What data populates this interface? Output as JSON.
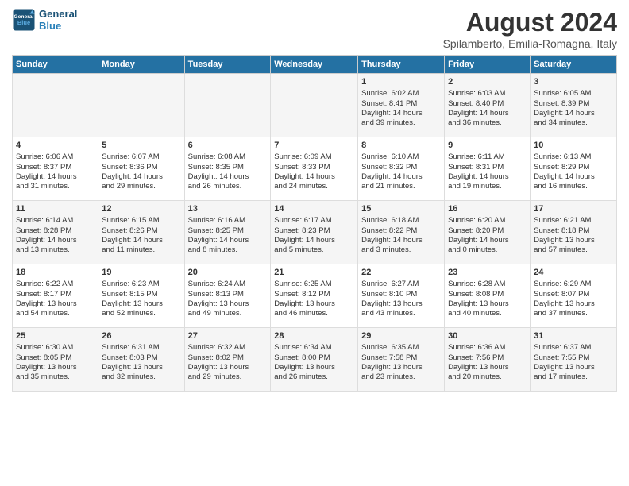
{
  "logo": {
    "line1": "General",
    "line2": "Blue"
  },
  "title": "August 2024",
  "subtitle": "Spilamberto, Emilia-Romagna, Italy",
  "days_of_week": [
    "Sunday",
    "Monday",
    "Tuesday",
    "Wednesday",
    "Thursday",
    "Friday",
    "Saturday"
  ],
  "weeks": [
    [
      {
        "day": "",
        "content": ""
      },
      {
        "day": "",
        "content": ""
      },
      {
        "day": "",
        "content": ""
      },
      {
        "day": "",
        "content": ""
      },
      {
        "day": "1",
        "content": "Sunrise: 6:02 AM\nSunset: 8:41 PM\nDaylight: 14 hours\nand 39 minutes."
      },
      {
        "day": "2",
        "content": "Sunrise: 6:03 AM\nSunset: 8:40 PM\nDaylight: 14 hours\nand 36 minutes."
      },
      {
        "day": "3",
        "content": "Sunrise: 6:05 AM\nSunset: 8:39 PM\nDaylight: 14 hours\nand 34 minutes."
      }
    ],
    [
      {
        "day": "4",
        "content": "Sunrise: 6:06 AM\nSunset: 8:37 PM\nDaylight: 14 hours\nand 31 minutes."
      },
      {
        "day": "5",
        "content": "Sunrise: 6:07 AM\nSunset: 8:36 PM\nDaylight: 14 hours\nand 29 minutes."
      },
      {
        "day": "6",
        "content": "Sunrise: 6:08 AM\nSunset: 8:35 PM\nDaylight: 14 hours\nand 26 minutes."
      },
      {
        "day": "7",
        "content": "Sunrise: 6:09 AM\nSunset: 8:33 PM\nDaylight: 14 hours\nand 24 minutes."
      },
      {
        "day": "8",
        "content": "Sunrise: 6:10 AM\nSunset: 8:32 PM\nDaylight: 14 hours\nand 21 minutes."
      },
      {
        "day": "9",
        "content": "Sunrise: 6:11 AM\nSunset: 8:31 PM\nDaylight: 14 hours\nand 19 minutes."
      },
      {
        "day": "10",
        "content": "Sunrise: 6:13 AM\nSunset: 8:29 PM\nDaylight: 14 hours\nand 16 minutes."
      }
    ],
    [
      {
        "day": "11",
        "content": "Sunrise: 6:14 AM\nSunset: 8:28 PM\nDaylight: 14 hours\nand 13 minutes."
      },
      {
        "day": "12",
        "content": "Sunrise: 6:15 AM\nSunset: 8:26 PM\nDaylight: 14 hours\nand 11 minutes."
      },
      {
        "day": "13",
        "content": "Sunrise: 6:16 AM\nSunset: 8:25 PM\nDaylight: 14 hours\nand 8 minutes."
      },
      {
        "day": "14",
        "content": "Sunrise: 6:17 AM\nSunset: 8:23 PM\nDaylight: 14 hours\nand 5 minutes."
      },
      {
        "day": "15",
        "content": "Sunrise: 6:18 AM\nSunset: 8:22 PM\nDaylight: 14 hours\nand 3 minutes."
      },
      {
        "day": "16",
        "content": "Sunrise: 6:20 AM\nSunset: 8:20 PM\nDaylight: 14 hours\nand 0 minutes."
      },
      {
        "day": "17",
        "content": "Sunrise: 6:21 AM\nSunset: 8:18 PM\nDaylight: 13 hours\nand 57 minutes."
      }
    ],
    [
      {
        "day": "18",
        "content": "Sunrise: 6:22 AM\nSunset: 8:17 PM\nDaylight: 13 hours\nand 54 minutes."
      },
      {
        "day": "19",
        "content": "Sunrise: 6:23 AM\nSunset: 8:15 PM\nDaylight: 13 hours\nand 52 minutes."
      },
      {
        "day": "20",
        "content": "Sunrise: 6:24 AM\nSunset: 8:13 PM\nDaylight: 13 hours\nand 49 minutes."
      },
      {
        "day": "21",
        "content": "Sunrise: 6:25 AM\nSunset: 8:12 PM\nDaylight: 13 hours\nand 46 minutes."
      },
      {
        "day": "22",
        "content": "Sunrise: 6:27 AM\nSunset: 8:10 PM\nDaylight: 13 hours\nand 43 minutes."
      },
      {
        "day": "23",
        "content": "Sunrise: 6:28 AM\nSunset: 8:08 PM\nDaylight: 13 hours\nand 40 minutes."
      },
      {
        "day": "24",
        "content": "Sunrise: 6:29 AM\nSunset: 8:07 PM\nDaylight: 13 hours\nand 37 minutes."
      }
    ],
    [
      {
        "day": "25",
        "content": "Sunrise: 6:30 AM\nSunset: 8:05 PM\nDaylight: 13 hours\nand 35 minutes."
      },
      {
        "day": "26",
        "content": "Sunrise: 6:31 AM\nSunset: 8:03 PM\nDaylight: 13 hours\nand 32 minutes."
      },
      {
        "day": "27",
        "content": "Sunrise: 6:32 AM\nSunset: 8:02 PM\nDaylight: 13 hours\nand 29 minutes."
      },
      {
        "day": "28",
        "content": "Sunrise: 6:34 AM\nSunset: 8:00 PM\nDaylight: 13 hours\nand 26 minutes."
      },
      {
        "day": "29",
        "content": "Sunrise: 6:35 AM\nSunset: 7:58 PM\nDaylight: 13 hours\nand 23 minutes."
      },
      {
        "day": "30",
        "content": "Sunrise: 6:36 AM\nSunset: 7:56 PM\nDaylight: 13 hours\nand 20 minutes."
      },
      {
        "day": "31",
        "content": "Sunrise: 6:37 AM\nSunset: 7:55 PM\nDaylight: 13 hours\nand 17 minutes."
      }
    ]
  ]
}
